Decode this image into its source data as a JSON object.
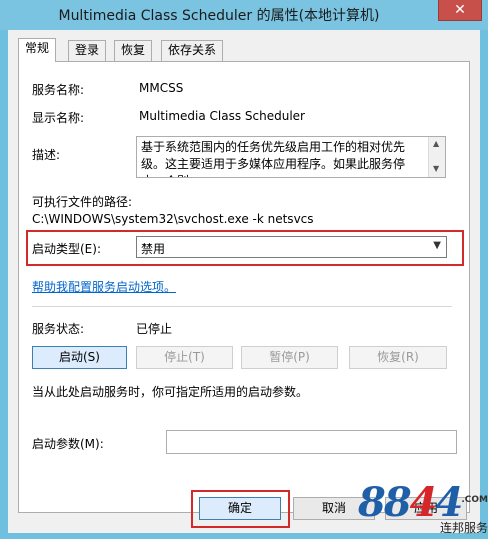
{
  "window": {
    "title": "Multimedia Class Scheduler 的属性(本地计算机)",
    "close_label": "✕"
  },
  "tabs": [
    {
      "label": "常规",
      "active": true
    },
    {
      "label": "登录",
      "active": false
    },
    {
      "label": "恢复",
      "active": false
    },
    {
      "label": "依存关系",
      "active": false
    }
  ],
  "general": {
    "service_name_label": "服务名称:",
    "service_name_value": "MMCSS",
    "display_name_label": "显示名称:",
    "display_name_value": "Multimedia Class Scheduler",
    "description_label": "描述:",
    "description_value": "基于系统范围内的任务优先级启用工作的相对优先级。这主要适用于多媒体应用程序。如果此服务停止，个别",
    "exe_path_label": "可执行文件的路径:",
    "exe_path_value": "C:\\WINDOWS\\system32\\svchost.exe -k netsvcs",
    "startup_type_label": "启动类型(E):",
    "startup_type_value": "禁用",
    "help_link": "帮助我配置服务启动选项。",
    "status_label": "服务状态:",
    "status_value": "已停止",
    "buttons": {
      "start": "启动(S)",
      "stop": "停止(T)",
      "pause": "暂停(P)",
      "resume": "恢复(R)"
    },
    "hint_text": "当从此处启动服务时，你可指定所适用的启动参数。",
    "start_params_label": "启动参数(M):",
    "start_params_value": ""
  },
  "footer": {
    "ok": "确定",
    "cancel": "取消",
    "apply": "应用"
  },
  "watermark": {
    "digits_a": "88",
    "digits_b": "4",
    "digit_c": "4",
    "com": ".COM",
    "name": "连邦服务"
  }
}
